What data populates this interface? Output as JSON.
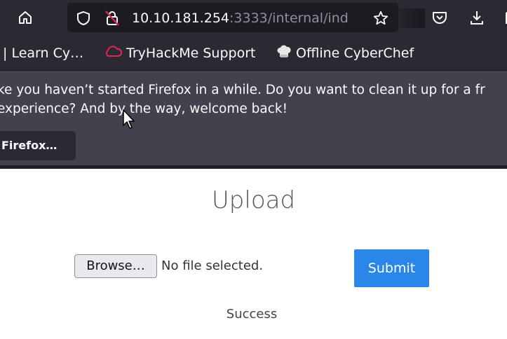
{
  "browser": {
    "url_host": "10.10.181.254",
    "url_rest": ":3333/internal/ind",
    "bookmarks": [
      {
        "label": "| Learn Cy…",
        "icon": "tab-icon"
      },
      {
        "label": "TryHackMe Support",
        "icon": "cloud-icon"
      },
      {
        "label": "Offline CyberChef",
        "icon": "chef-hat-icon"
      }
    ],
    "notification": {
      "line1": "ke you haven’t started Firefox in a while. Do you want to clean it up for a fr",
      "line2": "experience? And by the way, welcome back!",
      "button": "Firefox…"
    }
  },
  "page": {
    "title": "Upload",
    "browse_label": "Browse…",
    "file_status": "No file selected.",
    "submit_label": "Submit",
    "status_text": "Success"
  },
  "colors": {
    "toolbar_bg": "#2b2a33",
    "urlbar_bg": "#1c1b22",
    "notification_bg": "#42414d",
    "submit_bg": "#2a86e8",
    "cloud_icon": "#e22850"
  }
}
